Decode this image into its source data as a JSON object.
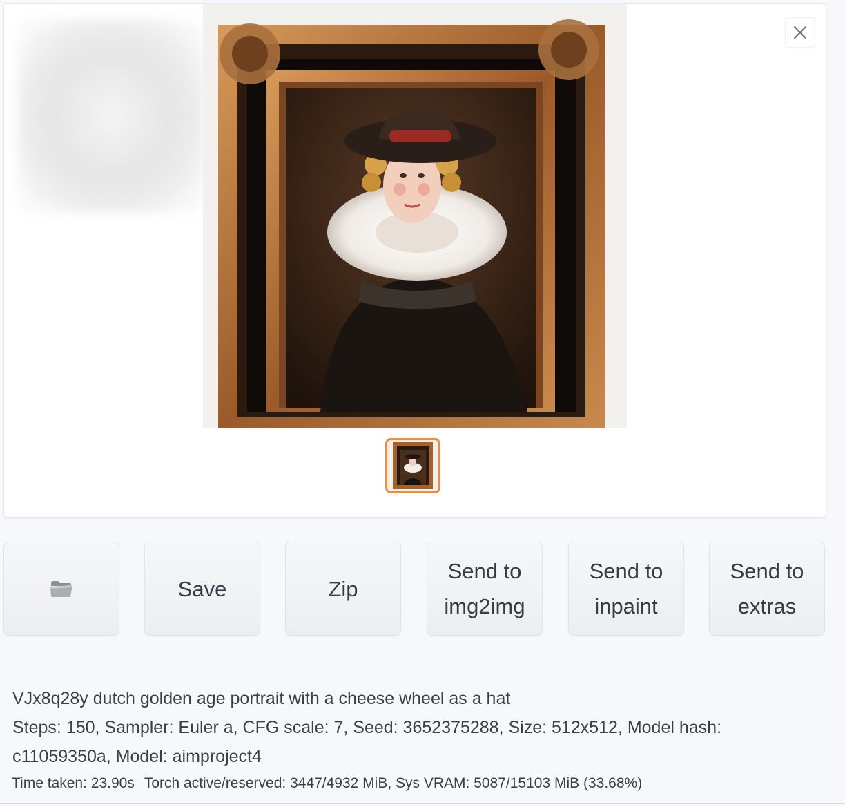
{
  "gallery": {
    "close_icon": "close-icon",
    "selected_index": 0,
    "thumbnail_count": 1
  },
  "actions": {
    "folder_icon": "folder-icon",
    "save_label": "Save",
    "zip_label": "Zip",
    "send_img2img_line1": "Send to",
    "send_img2img_line2": "img2img",
    "send_inpaint_line1": "Send to",
    "send_inpaint_line2": "inpaint",
    "send_extras_line1": "Send to",
    "send_extras_line2": "extras"
  },
  "generation_info": {
    "prompt": "VJx8q28y dutch golden age portrait with a cheese wheel as a hat",
    "params_line1": "Steps: 150, Sampler: Euler a, CFG scale: 7, Seed: 3652375288, Size: 512x512, Model hash:",
    "params_line2": "c11059350a, Model: aimproject4"
  },
  "performance": {
    "time_taken": "Time taken: 23.90s",
    "torch_vram": "Torch active/reserved: 3447/4932 MiB, Sys VRAM: 5087/15103 MiB (33.68%)"
  },
  "colors": {
    "accent_orange": "#f08a3c",
    "frame_gold": "#b5733a",
    "button_text": "#383c44"
  }
}
